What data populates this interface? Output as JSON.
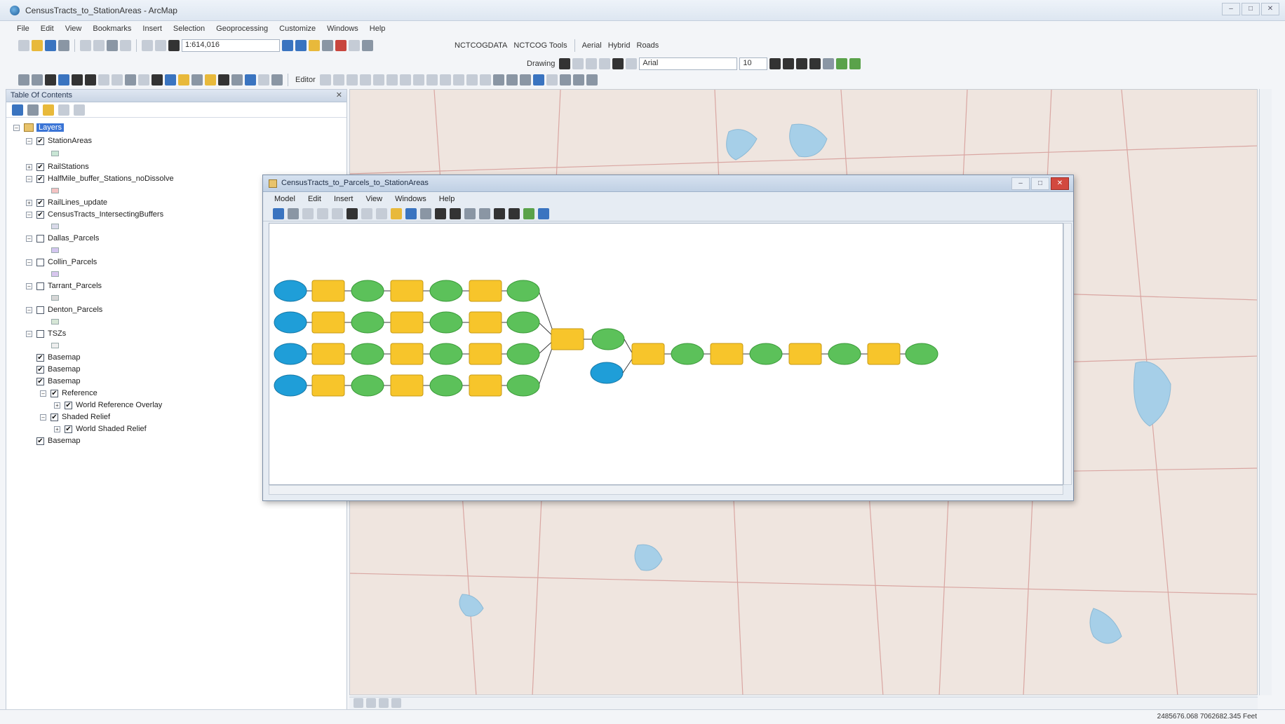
{
  "app": {
    "title": "CensusTracts_to_StationAreas - ArcMap",
    "menu": [
      "File",
      "Edit",
      "View",
      "Bookmarks",
      "Insert",
      "Selection",
      "Geoprocessing",
      "Customize",
      "Windows",
      "Help"
    ]
  },
  "toolbar": {
    "scale": "1:614,016",
    "toolbars_label": "NCTCOGDATA",
    "tools_label": "NCTCOG Tools",
    "basemap_aerial": "Aerial",
    "basemap_hybrid": "Hybrid",
    "basemap_roads": "Roads",
    "drawing_label": "Drawing",
    "font_name": "Arial",
    "font_size": "10",
    "editor_label": "Editor"
  },
  "toc": {
    "title": "Table Of Contents",
    "root_label": "Layers",
    "layers": [
      {
        "label": "StationAreas",
        "checked": true,
        "symbol": "#c9e6d5"
      },
      {
        "label": "RailStations",
        "checked": true,
        "symbol": null
      },
      {
        "label": "HalfMile_buffer_Stations_noDissolve",
        "checked": true,
        "symbol": "#f4c2c2"
      },
      {
        "label": "RailLines_update",
        "checked": true,
        "symbol": null
      },
      {
        "label": "CensusTracts_IntersectingBuffers",
        "checked": true,
        "symbol": "#d9d9e9"
      },
      {
        "label": "Dallas_Parcels",
        "checked": false,
        "symbol": "#d4c6f0"
      },
      {
        "label": "Collin_Parcels",
        "checked": false,
        "symbol": "#d8c6ee"
      },
      {
        "label": "Tarrant_Parcels",
        "checked": false,
        "symbol": "#d6d6d6"
      },
      {
        "label": "Denton_Parcels",
        "checked": false,
        "symbol": "#d6e6d6"
      },
      {
        "label": "TSZs",
        "checked": false,
        "symbol": "#eeeeee"
      },
      {
        "label": "Basemap",
        "checked": true,
        "symbol": null
      },
      {
        "label": "Basemap",
        "checked": true,
        "symbol": null
      },
      {
        "label": "Basemap",
        "checked": true,
        "symbol": null
      },
      {
        "label": "Reference",
        "checked": true,
        "symbol": null
      },
      {
        "label": "World Reference Overlay",
        "checked": true,
        "symbol": null
      },
      {
        "label": "Shaded Relief",
        "checked": true,
        "symbol": null
      },
      {
        "label": "World Shaded Relief",
        "checked": true,
        "symbol": null
      },
      {
        "label": "Basemap",
        "checked": true,
        "symbol": null
      }
    ]
  },
  "modelbuilder": {
    "title": "CensusTracts_to_Parcels_to_StationAreas",
    "menu": [
      "Model",
      "Edit",
      "Insert",
      "View",
      "Windows",
      "Help"
    ]
  },
  "status": {
    "coordinates": "2485676.068  7062682.345 Feet"
  },
  "colors": {
    "data_input": "#1f9ed8",
    "tool": "#f7c52b",
    "derived_data": "#5cc15a"
  }
}
